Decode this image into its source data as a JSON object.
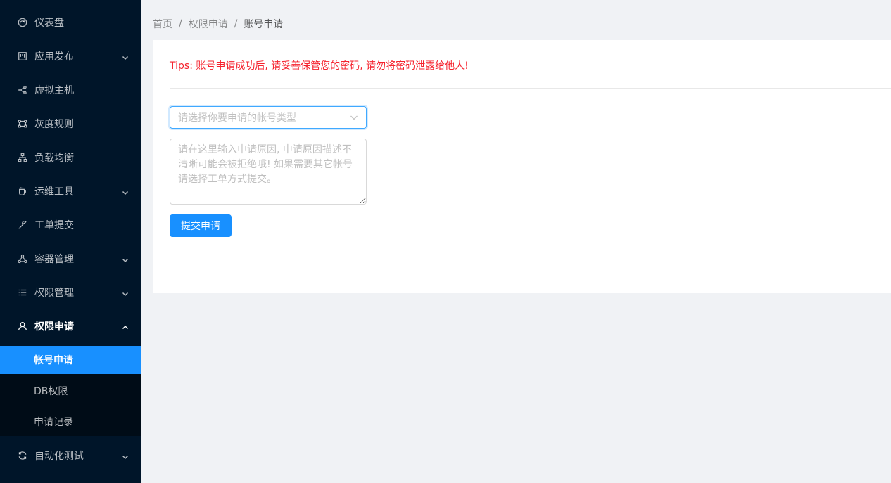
{
  "sidebar": {
    "items": [
      {
        "label": "仪表盘",
        "icon": "dashboard-icon",
        "has_arrow": false
      },
      {
        "label": "应用发布",
        "icon": "project-icon",
        "has_arrow": true
      },
      {
        "label": "虚拟主机",
        "icon": "share-icon",
        "has_arrow": false
      },
      {
        "label": "灰度规则",
        "icon": "gateway-icon",
        "has_arrow": false
      },
      {
        "label": "负载均衡",
        "icon": "cluster-icon",
        "has_arrow": false
      },
      {
        "label": "运维工具",
        "icon": "coffee-icon",
        "has_arrow": true
      },
      {
        "label": "工单提交",
        "icon": "tool-icon",
        "has_arrow": false
      },
      {
        "label": "容器管理",
        "icon": "deployment-icon",
        "has_arrow": true
      },
      {
        "label": "权限管理",
        "icon": "list-icon",
        "has_arrow": true
      },
      {
        "label": "权限申请",
        "icon": "user-icon",
        "has_arrow": true,
        "open": true
      }
    ],
    "submenu": [
      {
        "label": "帐号申请",
        "active": true
      },
      {
        "label": "DB权限",
        "active": false
      },
      {
        "label": "申请记录",
        "active": false
      }
    ],
    "after_items": [
      {
        "label": "自动化测试",
        "icon": "sync-icon",
        "has_arrow": true
      }
    ]
  },
  "breadcrumb": {
    "items": [
      "首页",
      "权限申请",
      "账号申请"
    ],
    "separator": "/"
  },
  "content": {
    "tips": "Tips: 账号申请成功后, 请妥善保管您的密码, 请勿将密码泄露给他人!",
    "select_placeholder": "请选择你要申请的帐号类型",
    "textarea_placeholder": "请在这里输入申请原因, 申请原因描述不清晰可能会被拒绝哦! 如果需要其它帐号请选择工单方式提交。",
    "submit_label": "提交申请"
  },
  "colors": {
    "sidebar_bg": "#001529",
    "submenu_bg": "#000c17",
    "primary": "#1890ff",
    "tips": "#f5222d"
  }
}
